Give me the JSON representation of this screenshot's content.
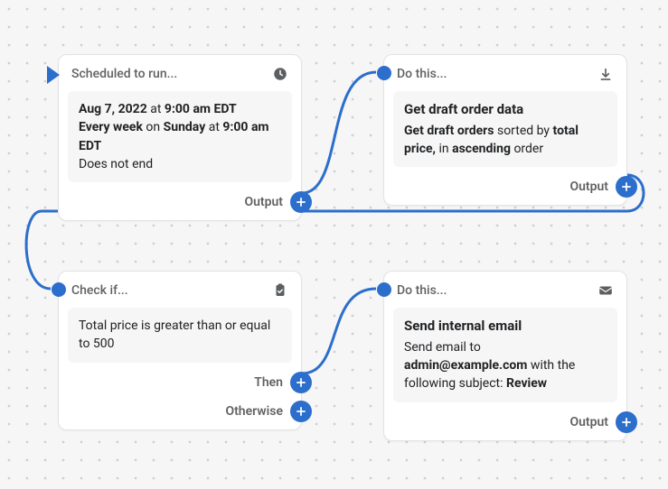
{
  "nodes": {
    "schedule": {
      "header": "Scheduled to run...",
      "start_date": "Aug 7, 2022",
      "at1": "at",
      "start_time": "9:00 am EDT",
      "freq": "Every week",
      "on": "on",
      "day": "Sunday",
      "at2": "at",
      "time2": "9:00 am EDT",
      "end_note": "Does not end",
      "output_label": "Output"
    },
    "getData": {
      "header": "Do this...",
      "title": "Get draft order data",
      "l1a": "Get draft orders",
      "l1b": "sorted by",
      "l1c": "total price,",
      "l1d": "in",
      "l1e": "ascending",
      "l1f": "order",
      "output_label": "Output"
    },
    "check": {
      "header": "Check if...",
      "body": "Total price is greater than or equal to 500",
      "then_label": "Then",
      "otherwise_label": "Otherwise"
    },
    "email": {
      "header": "Do this...",
      "title": "Send internal email",
      "l1": "Send email to",
      "addr": "admin@example.com",
      "l2": "with the following subject:",
      "subj": "Review",
      "output_label": "Output"
    }
  }
}
